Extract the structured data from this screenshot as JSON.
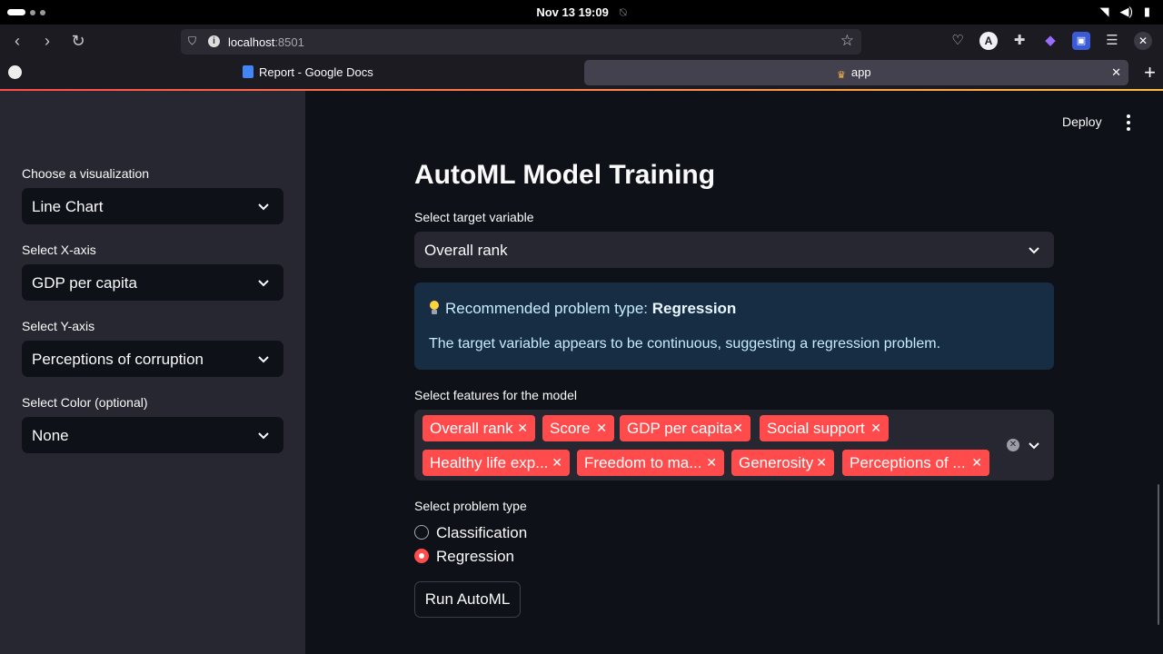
{
  "os": {
    "clock": "Nov 13  19:09"
  },
  "browser": {
    "url_host": "localhost",
    "url_port": ":8501",
    "tabs": [
      {
        "label": "Report - Google Docs",
        "active": false
      },
      {
        "label": "app",
        "active": true
      }
    ],
    "avatar_letter": "A"
  },
  "sidebar": {
    "visualization_label": "Choose a visualization",
    "visualization_value": "Line Chart",
    "x_label": "Select X-axis",
    "x_value": "GDP per capita",
    "y_label": "Select Y-axis",
    "y_value": "Perceptions of corruption",
    "color_label": "Select Color (optional)",
    "color_value": "None"
  },
  "header": {
    "deploy_label": "Deploy"
  },
  "main": {
    "title": "AutoML Model Training",
    "target_label": "Select target variable",
    "target_value": "Overall rank",
    "info": {
      "prefix": "Recommended problem type: ",
      "type": "Regression",
      "message": "The target variable appears to be continuous, suggesting a regression problem."
    },
    "features_label": "Select features for the model",
    "features": [
      "Overall rank",
      "Score",
      "GDP per capita",
      "Social support",
      "Healthy life exp...",
      "Freedom to ma...",
      "Generosity",
      "Perceptions of ..."
    ],
    "problem_type_label": "Select problem type",
    "problem_types": [
      {
        "label": "Classification",
        "selected": false
      },
      {
        "label": "Regression",
        "selected": true
      }
    ],
    "run_button": "Run AutoML"
  },
  "colors": {
    "accent": "#ff4b4b",
    "sidebar_bg": "#262730",
    "main_bg": "#0e1117",
    "info_bg": "#172d43"
  }
}
